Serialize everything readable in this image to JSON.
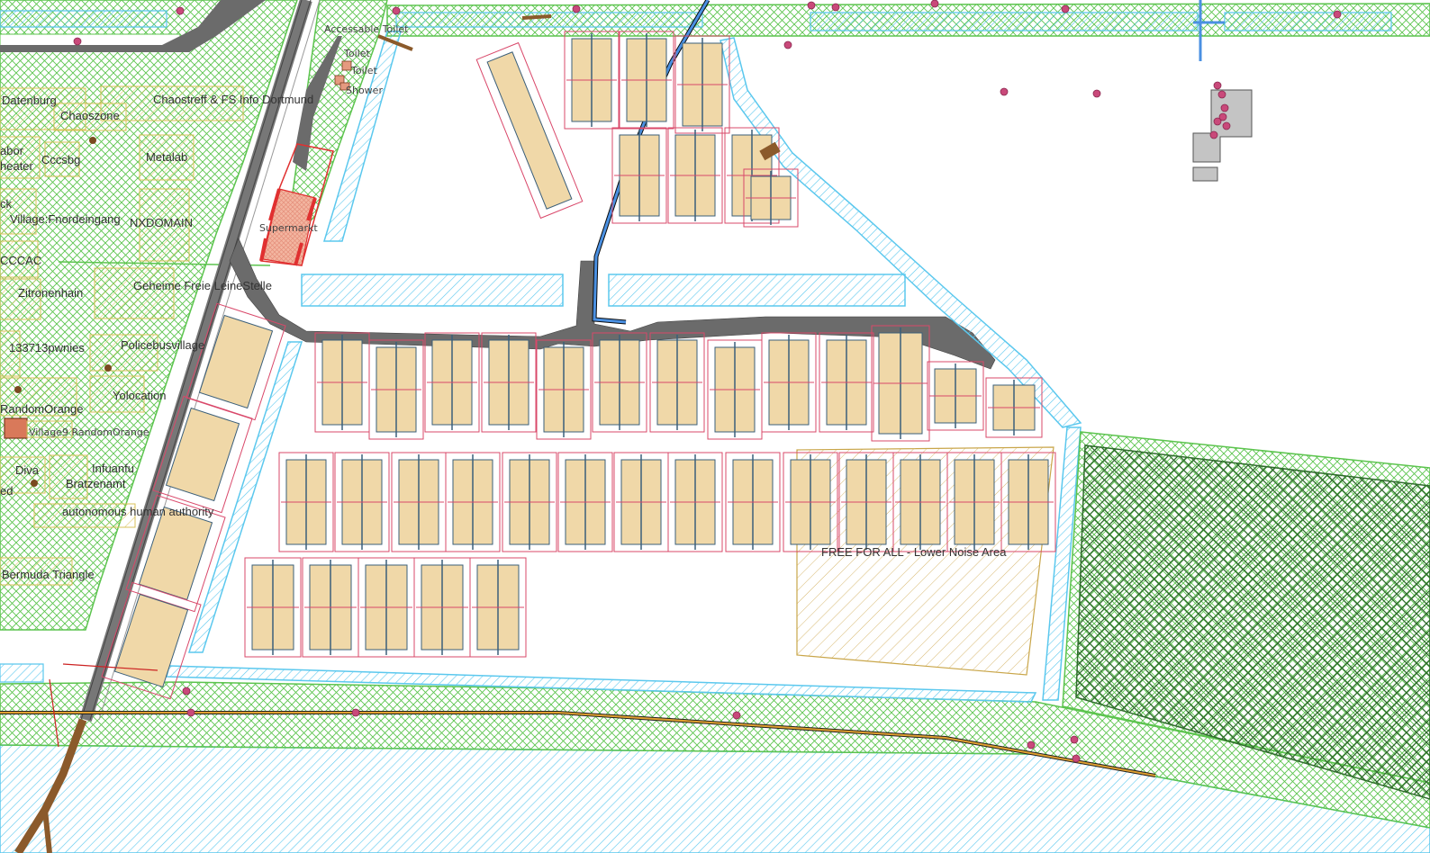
{
  "colors": {
    "water_stroke": "#5bc8ee",
    "green_stroke": "#5cc44e",
    "dark_green": "#2f6b2c",
    "village_stroke": "#d9c25a",
    "tent_fill": "#f0d8a8",
    "tent_stroke": "#3b5f7a",
    "plot_stroke": "#d9486a",
    "road": "#6b6b6b",
    "free_area": "#c9a64a",
    "fence_brown": "#8b5a2b",
    "poi": "#c9497a",
    "building": "#c4c4c4",
    "supermarkt_red": "#e03030"
  },
  "labels": {
    "accessable_toilet": "Accessable Toilet",
    "toilet_1": "Toilet",
    "toilet_2": "Toilet",
    "shower": "Shower",
    "supermarkt": "Supermarkt",
    "datenburg": "Datenburg",
    "chaostreff": "Chaostreff & FS Info Dortmund",
    "chaoszone": "Chaoszone",
    "abor": "abor",
    "heater": "heater",
    "cccsbg": "Cccsbg",
    "metalab": "Metalab",
    "ck": "ck",
    "fnordeingang": "Village:Fnordeingang",
    "nxdomain": "NXDOMAIN",
    "cccac": "CCCAC",
    "zitronenhain": "Zitronenhain",
    "geheime": "Geheime Freie LeineStelle",
    "pwnies": "133713pwnies",
    "policebus": "Policebusvillage",
    "yolocation": "Yolocation",
    "randomorange": "RandomOrange",
    "village9": "Village9 RandomOrange",
    "diva": "Diva",
    "infuanfu": "Infuanfu",
    "ed": "ed",
    "bratzenamt": "Bratzenamt",
    "autonomous": "autonomous human authority",
    "bermuda": "Bermuda Triangle",
    "free_for_all": "FREE FOR ALL - Lower Noise Area"
  }
}
